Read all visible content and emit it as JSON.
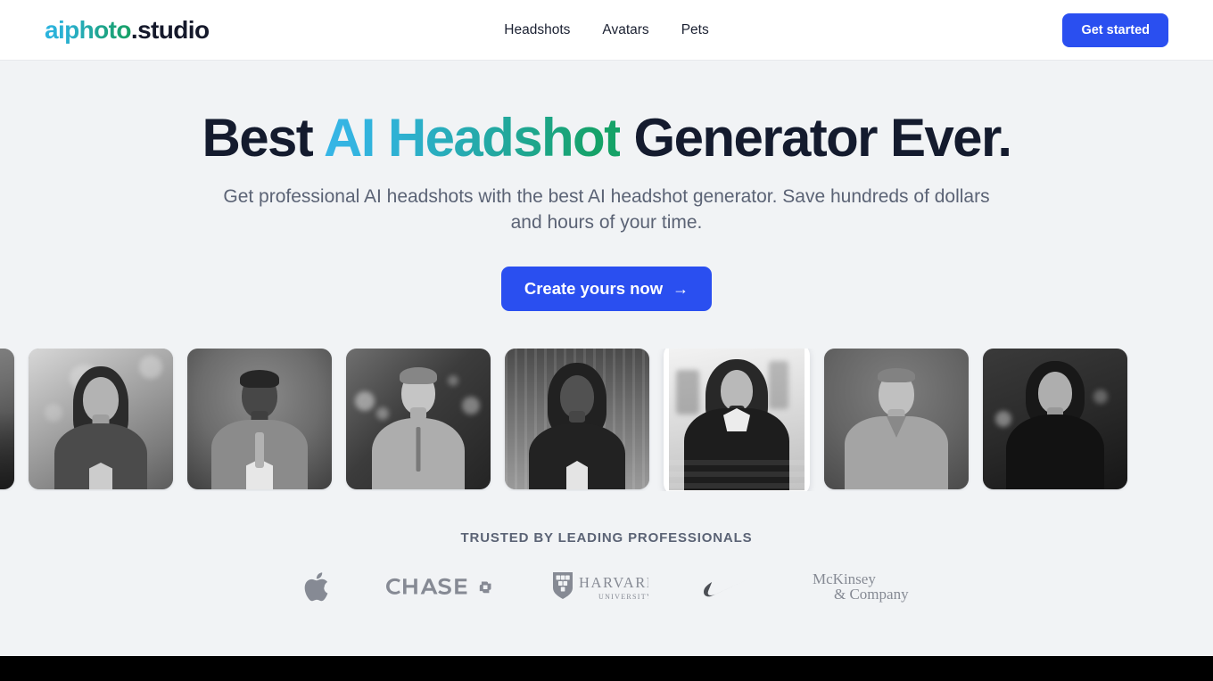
{
  "header": {
    "logo_mark": "aiphoto",
    "logo_tld": ".studio",
    "nav": [
      {
        "label": "Headshots",
        "name": "nav-link-headshots"
      },
      {
        "label": "Avatars",
        "name": "nav-link-avatars"
      },
      {
        "label": "Pets",
        "name": "nav-link-pets"
      }
    ],
    "cta_label": "Get started"
  },
  "hero": {
    "title_part1": "Best ",
    "title_gradient": "AI Headshot",
    "title_part2": " Generator Ever.",
    "subtitle": "Get professional AI headshots with the best AI headshot generator. Save hundreds of dollars and hours of your time.",
    "cta_label": "Create yours now",
    "cta_arrow": "→"
  },
  "gallery": {
    "items": [
      {
        "alt": "businessman-in-suit-mountain-backdrop",
        "featured": false
      },
      {
        "alt": "woman-in-scrubs-outdoor-bokeh",
        "featured": false
      },
      {
        "alt": "smiling-man-in-suit-studio",
        "featured": false
      },
      {
        "alt": "young-man-quarter-zip-city-lights",
        "featured": false
      },
      {
        "alt": "woman-in-blazer-city-skyline",
        "featured": false
      },
      {
        "alt": "woman-in-winter-puffer-jacket-snow",
        "featured": true
      },
      {
        "alt": "man-in-medical-scrubs-studio",
        "featured": false
      },
      {
        "alt": "woman-in-turtleneck-night-city",
        "featured": false
      }
    ]
  },
  "trusted": {
    "label": "TRUSTED BY LEADING PROFESSIONALS",
    "brands": [
      {
        "name": "apple",
        "label": "Apple"
      },
      {
        "name": "chase",
        "label": "CHASE"
      },
      {
        "name": "harvard",
        "label": "HARVARD",
        "sub": "UNIVERSITY"
      },
      {
        "name": "nike",
        "label": "Nike"
      },
      {
        "name": "mckinsey",
        "label": "McKinsey",
        "sub": "& Company"
      }
    ]
  },
  "colors": {
    "accent_blue": "#2a4ff0",
    "gradient_start": "#38b6e8",
    "gradient_end": "#15a267",
    "page_bg": "#f1f3f5",
    "text_dark": "#141b2e",
    "text_muted": "#5b6375",
    "footer_bg": "#000000"
  }
}
